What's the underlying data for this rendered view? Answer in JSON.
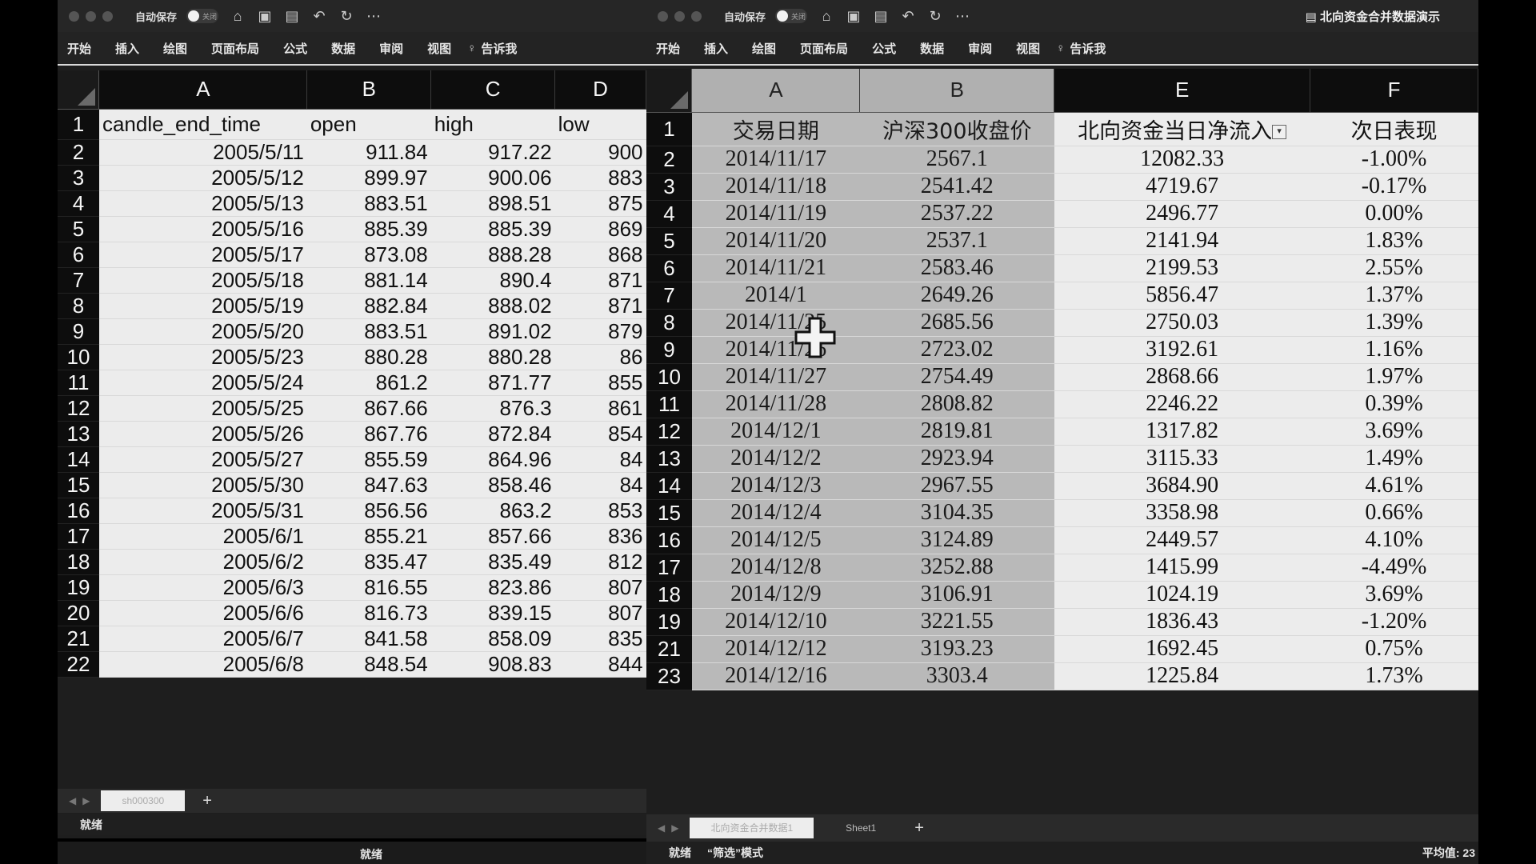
{
  "left_window": {
    "titlebar": {
      "autosave_label": "自动保存",
      "toggle_text": "关闭",
      "icons": [
        "home-icon",
        "save-icon",
        "save-as-icon",
        "undo-icon",
        "redo-icon",
        "more-icon"
      ]
    },
    "ribbon": [
      "开始",
      "插入",
      "绘图",
      "页面布局",
      "公式",
      "数据",
      "审阅",
      "视图"
    ],
    "tell_me": "告诉我",
    "columns": [
      "A",
      "B",
      "C",
      "D"
    ],
    "header_row": [
      "candle_end_time",
      "open",
      "high",
      "low"
    ],
    "rows": [
      [
        "2",
        "2005/5/11",
        "911.84",
        "917.22",
        "900"
      ],
      [
        "3",
        "2005/5/12",
        "899.97",
        "900.06",
        "883"
      ],
      [
        "4",
        "2005/5/13",
        "883.51",
        "898.51",
        "875"
      ],
      [
        "5",
        "2005/5/16",
        "885.39",
        "885.39",
        "869"
      ],
      [
        "6",
        "2005/5/17",
        "873.08",
        "888.28",
        "868"
      ],
      [
        "7",
        "2005/5/18",
        "881.14",
        "890.4",
        "871"
      ],
      [
        "8",
        "2005/5/19",
        "882.84",
        "888.02",
        "871"
      ],
      [
        "9",
        "2005/5/20",
        "883.51",
        "891.02",
        "879"
      ],
      [
        "10",
        "2005/5/23",
        "880.28",
        "880.28",
        "86"
      ],
      [
        "11",
        "2005/5/24",
        "861.2",
        "871.77",
        "855"
      ],
      [
        "12",
        "2005/5/25",
        "867.66",
        "876.3",
        "861"
      ],
      [
        "13",
        "2005/5/26",
        "867.76",
        "872.84",
        "854"
      ],
      [
        "14",
        "2005/5/27",
        "855.59",
        "864.96",
        "84"
      ],
      [
        "15",
        "2005/5/30",
        "847.63",
        "858.46",
        "84"
      ],
      [
        "16",
        "2005/5/31",
        "856.56",
        "863.2",
        "853"
      ],
      [
        "17",
        "2005/6/1",
        "855.21",
        "857.66",
        "836"
      ],
      [
        "18",
        "2005/6/2",
        "835.47",
        "835.49",
        "812"
      ],
      [
        "19",
        "2005/6/3",
        "816.55",
        "823.86",
        "807"
      ],
      [
        "20",
        "2005/6/6",
        "816.73",
        "839.15",
        "807"
      ],
      [
        "21",
        "2005/6/7",
        "841.58",
        "858.09",
        "835"
      ],
      [
        "22",
        "2005/6/8",
        "848.54",
        "908.83",
        "844"
      ]
    ],
    "sheet_tab": "sh000300",
    "status": "就绪",
    "bottom_status": "就绪"
  },
  "right_window": {
    "titlebar": {
      "autosave_label": "自动保存",
      "toggle_text": "关闭",
      "doc_title": "北向资金合并数据演示",
      "icons": [
        "home-icon",
        "save-icon",
        "save-as-icon",
        "undo-icon",
        "redo-icon",
        "more-icon"
      ]
    },
    "ribbon": [
      "开始",
      "插入",
      "绘图",
      "页面布局",
      "公式",
      "数据",
      "审阅",
      "视图"
    ],
    "tell_me": "告诉我",
    "columns": [
      "A",
      "B",
      "E",
      "F"
    ],
    "header_row": [
      "交易日期",
      "沪深300收盘价",
      "北向资金当日净流入",
      "次日表现"
    ],
    "rows": [
      [
        "2",
        "2014/11/17",
        "2567.1",
        "12082.33",
        "-1.00%"
      ],
      [
        "3",
        "2014/11/18",
        "2541.42",
        "4719.67",
        "-0.17%"
      ],
      [
        "4",
        "2014/11/19",
        "2537.22",
        "2496.77",
        "0.00%"
      ],
      [
        "5",
        "2014/11/20",
        "2537.1",
        "2141.94",
        "1.83%"
      ],
      [
        "6",
        "2014/11/21",
        "2583.46",
        "2199.53",
        "2.55%"
      ],
      [
        "7",
        "2014/1",
        "2649.26",
        "5856.47",
        "1.37%"
      ],
      [
        "8",
        "2014/11/25",
        "2685.56",
        "2750.03",
        "1.39%"
      ],
      [
        "9",
        "2014/11/26",
        "2723.02",
        "3192.61",
        "1.16%"
      ],
      [
        "10",
        "2014/11/27",
        "2754.49",
        "2868.66",
        "1.97%"
      ],
      [
        "11",
        "2014/11/28",
        "2808.82",
        "2246.22",
        "0.39%"
      ],
      [
        "12",
        "2014/12/1",
        "2819.81",
        "1317.82",
        "3.69%"
      ],
      [
        "13",
        "2014/12/2",
        "2923.94",
        "3115.33",
        "1.49%"
      ],
      [
        "14",
        "2014/12/3",
        "2967.55",
        "3684.90",
        "4.61%"
      ],
      [
        "15",
        "2014/12/4",
        "3104.35",
        "3358.98",
        "0.66%"
      ],
      [
        "16",
        "2014/12/5",
        "3124.89",
        "2449.57",
        "4.10%"
      ],
      [
        "17",
        "2014/12/8",
        "3252.88",
        "1415.99",
        "-4.49%"
      ],
      [
        "18",
        "2014/12/9",
        "3106.91",
        "1024.19",
        "3.69%"
      ],
      [
        "19",
        "2014/12/10",
        "3221.55",
        "1836.43",
        "-1.20%"
      ],
      [
        "21",
        "2014/12/12",
        "3193.23",
        "1692.45",
        "0.75%"
      ],
      [
        "23",
        "2014/12/16",
        "3303.4",
        "1225.84",
        "1.73%"
      ]
    ],
    "sheet_tabs": [
      "北向资金合并数据1",
      "Sheet1"
    ],
    "status": "就绪",
    "status_mode": "“筛选”模式",
    "status_right": "平均值: 23"
  }
}
